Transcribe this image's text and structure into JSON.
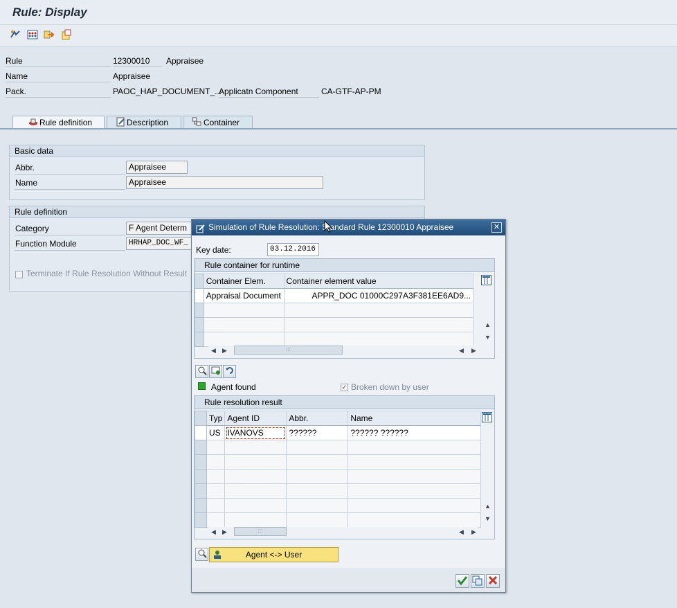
{
  "window": {
    "title": "Rule: Display"
  },
  "toolbar": {
    "icons": [
      "rule-simulate-icon",
      "bindings-icon",
      "export-icon",
      "where-used-icon"
    ]
  },
  "header": {
    "rule_label": "Rule",
    "rule_id": "12300010",
    "rule_name": "Appraisee",
    "name_label": "Name",
    "name_value": "Appraisee",
    "pack_label": "Pack.",
    "pack_value": "PAOC_HAP_DOCUMENT_...",
    "appcomp_label": "Applicatn Component",
    "appcomp_value": "CA-GTF-AP-PM"
  },
  "tabs": [
    {
      "label": "Rule definition",
      "icon": "rule-icon",
      "active": true
    },
    {
      "label": "Description",
      "icon": "edit-document-icon",
      "active": false
    },
    {
      "label": "Container",
      "icon": "container-icon",
      "active": false
    }
  ],
  "basic_data": {
    "title": "Basic data",
    "abbr_label": "Abbr.",
    "abbr_value": "Appraisee",
    "name_label": "Name",
    "name_value": "Appraisee"
  },
  "rule_definition": {
    "title": "Rule definition",
    "category_label": "Category",
    "category_value": "F Agent Determ",
    "fm_label": "Function Module",
    "fm_value": "HRHAP_DOC_WF_",
    "terminate_label": "Terminate If Rule Resolution Without Result",
    "terminate_checked": false
  },
  "dialog": {
    "title": "Simulation of Rule Resolution: Standard Rule 12300010 Appraisee",
    "key_date_label": "Key date:",
    "key_date_value": "03.12.2016",
    "container_section": {
      "title": "Rule container for runtime",
      "columns": [
        "Container Elem.",
        "Container element value"
      ],
      "rows": [
        {
          "elem": "Appraisal Document",
          "value": "APPR_DOC  01000C297A3F381EE6AD9..."
        }
      ]
    },
    "agent_found_label": "Agent found",
    "agent_found_color": "#2ea52e",
    "broken_down_label": "Broken down by user",
    "broken_down_checked": true,
    "result_section": {
      "title": "Rule resolution result",
      "columns": [
        "Typ",
        "Agent ID",
        "Abbr.",
        "Name"
      ],
      "rows": [
        {
          "typ": "US",
          "agent_id": "IVANOVS",
          "abbr": "??????",
          "name": "?????? ??????"
        }
      ]
    },
    "agent_user_button": "Agent <-> User",
    "footer_icons": [
      "confirm-icon",
      "copy-icon",
      "cancel-icon"
    ]
  }
}
